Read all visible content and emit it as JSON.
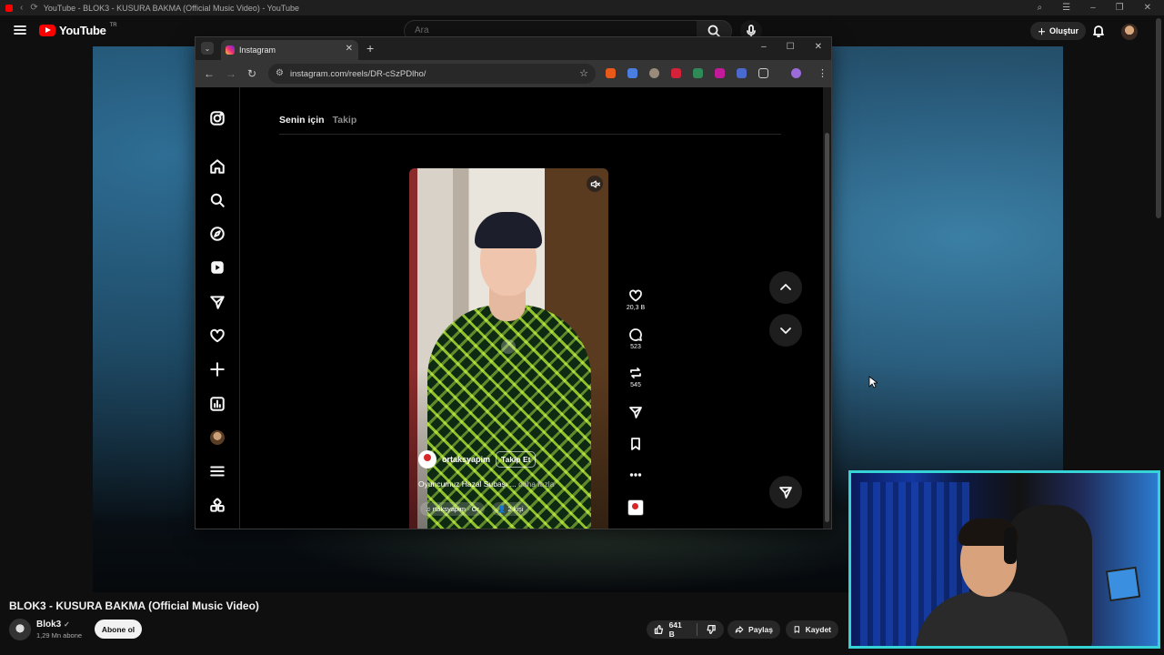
{
  "outer_browser": {
    "tab_title": "YouTube - BLOK3 - KUSURA BAKMA (Official Music Video) - YouTube"
  },
  "youtube": {
    "logo_text": "YouTube",
    "logo_country": "TR",
    "search_placeholder": "Ara",
    "create_label": "Oluştur",
    "video_title": "BLOK3 - KUSURA BAKMA (Official Music Video)",
    "channel_name": "Blok3",
    "channel_subs": "1,29 Mn abone",
    "subscribe_label": "Abone ol",
    "like_count": "641 B",
    "share_label": "Paylaş",
    "save_label": "Kaydet",
    "brand_color": "#ff0000"
  },
  "chrome": {
    "tab_title": "Instagram",
    "url": "instagram.com/reels/DR-cSzPDlho/"
  },
  "instagram": {
    "tabs": {
      "for_you": "Senin için",
      "following": "Takip"
    },
    "reel": {
      "username": "ortaksyapim",
      "follow_label": "Takip Et",
      "caption": "Oyuncumuz Hazal Subaşı ...",
      "caption_more": "daha fazla",
      "audio": "rtaksyapim · Or",
      "people": "2 kişi"
    },
    "actions": {
      "likes": "20,3 B",
      "comments": "523",
      "reposts": "545"
    }
  },
  "webcam": {
    "border_color": "#35d3d6"
  }
}
